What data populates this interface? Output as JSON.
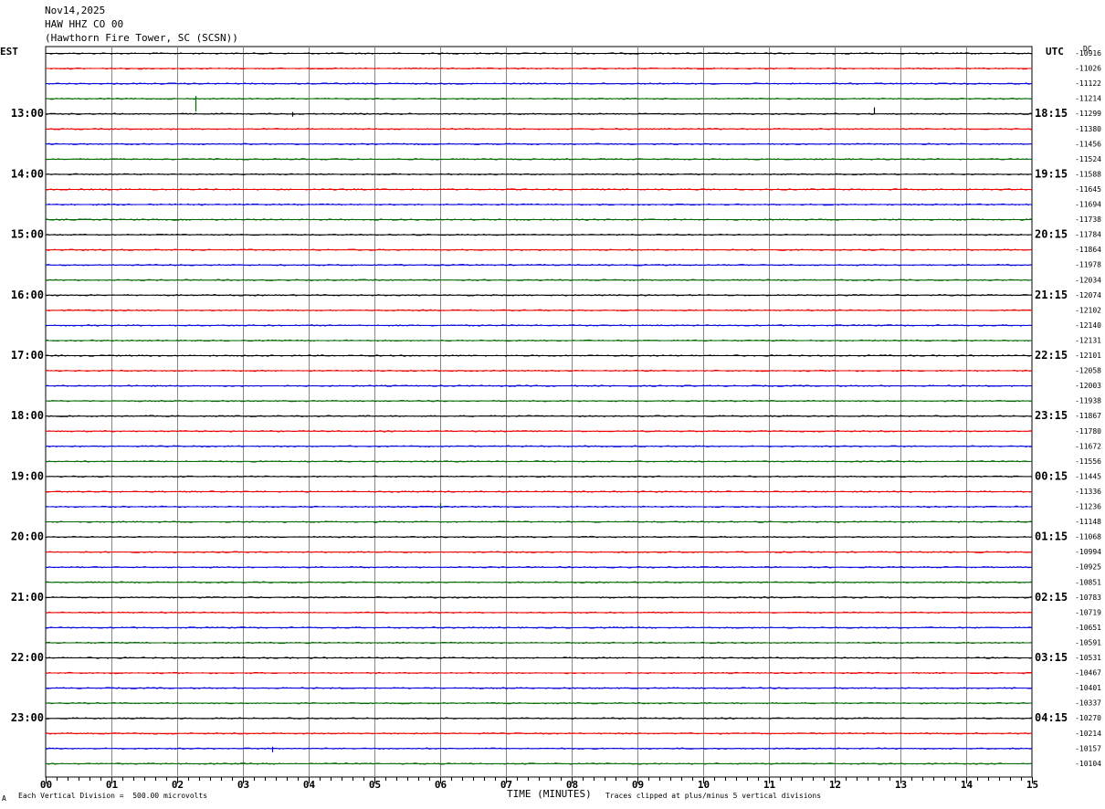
{
  "header": {
    "date": "Nov14,2025",
    "station": "HAW HHZ CO 00",
    "location": "(Hawthorn Fire Tower, SC (SCSN))"
  },
  "left_tz": "EST",
  "right_tz": "UTC",
  "dc_label": "DC",
  "footer": {
    "scale": "Each Vertical Division =  500.00 microvolts",
    "xlabel": "TIME (MINUTES)",
    "clip_note": "Traces clipped at plus/minus 5 vertical divisions",
    "corner_mark": "A"
  },
  "colors": {
    "black": "#000000",
    "red": "#ee0000",
    "blue": "#0000dd",
    "green": "#006600",
    "grid": "#888888"
  },
  "chart_data": {
    "type": "line",
    "title": "Nov14,2025 HAW HHZ CO 00 (Hawthorn Fire Tower, SC (SCSN))",
    "xlabel": "TIME (MINUTES)",
    "x_ticks": [
      "00",
      "01",
      "02",
      "03",
      "04",
      "05",
      "06",
      "07",
      "08",
      "09",
      "10",
      "11",
      "12",
      "13",
      "14",
      "15"
    ],
    "xlim": [
      0,
      15
    ],
    "left_hour_labels": [
      "13:00",
      "14:00",
      "15:00",
      "16:00",
      "17:00",
      "18:00",
      "19:00",
      "20:00",
      "21:00",
      "22:00",
      "23:00"
    ],
    "right_hour_labels": [
      "18:15",
      "19:15",
      "20:15",
      "21:15",
      "22:15",
      "23:15",
      "00:15",
      "01:15",
      "02:15",
      "03:15",
      "04:15"
    ],
    "trace_color_cycle": [
      "black",
      "red",
      "blue",
      "green"
    ],
    "dc_offsets": [
      -10916,
      -11026,
      -11122,
      -11214,
      -11299,
      -11380,
      -11456,
      -11524,
      -11588,
      -11645,
      -11694,
      -11738,
      -11784,
      -11864,
      -11978,
      -12034,
      -12074,
      -12102,
      -12140,
      -12131,
      -12101,
      -12058,
      -12003,
      -11938,
      -11867,
      -11780,
      -11672,
      -11556,
      -11445,
      -11336,
      -11236,
      -11148,
      -11068,
      -10994,
      -10925,
      -10851,
      -10783,
      -10719,
      -10651,
      -10591,
      -10531,
      -10467,
      -10401,
      -10337,
      -10270,
      -10214,
      -10157,
      -10104
    ],
    "vertical_division_microvolts": 500.0,
    "clip_divisions": 5,
    "grid": true
  }
}
